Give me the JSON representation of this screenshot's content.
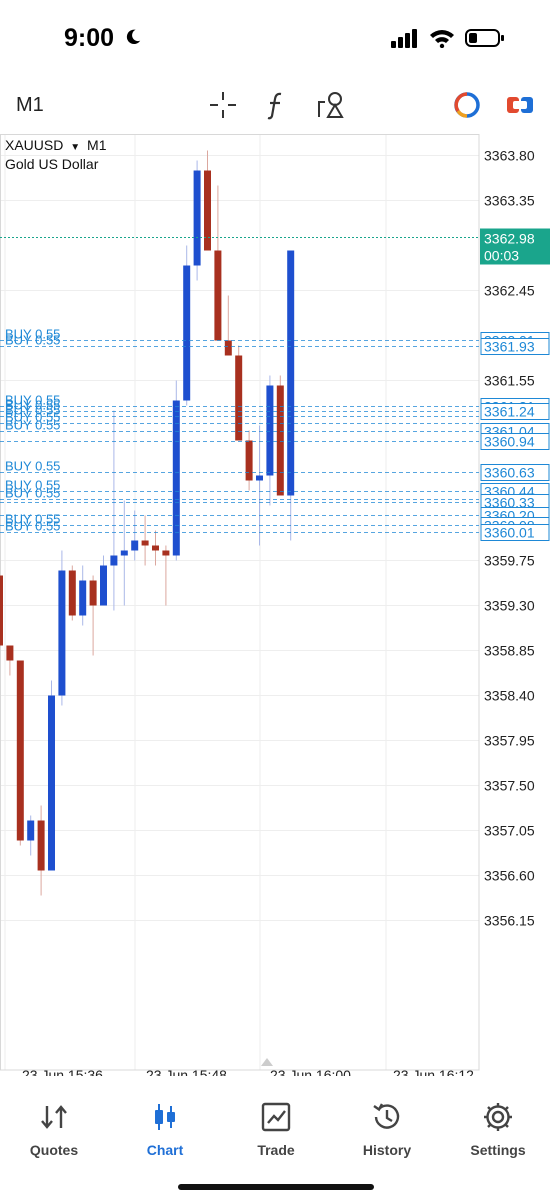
{
  "status": {
    "time": "9:00"
  },
  "toolbar": {
    "timeframe": "M1",
    "icons": [
      "crosshair-icon",
      "indicators-f-icon",
      "objects-icon",
      "color-scheme-icon",
      "one-click-trading-icon"
    ]
  },
  "chart": {
    "symbol": "XAUUSD",
    "timeframe": "M1",
    "description": "Gold US Dollar",
    "current_price": "3362.98",
    "countdown": "00:03",
    "colors": {
      "bull": "#1e4fcf",
      "bear": "#a8301f",
      "order_line": "#1e88d6",
      "bid_line": "#1aa58c",
      "grid": "#eeeeee"
    }
  },
  "chart_data": {
    "type": "candlestick",
    "y_ticks": [
      "3363.80",
      "3363.35",
      "3362.45",
      "3361.55",
      "3359.75",
      "3359.30",
      "3358.85",
      "3358.40",
      "3357.95",
      "3357.50",
      "3357.05",
      "3356.60",
      "3356.15"
    ],
    "x_ticks": [
      "23 Jun 15:36",
      "23 Jun 15:48",
      "23 Jun 16:00",
      "23 Jun 16:12"
    ],
    "ylim": [
      3355.8,
      3364.0
    ],
    "candles": [
      {
        "o": 3359.6,
        "h": 3359.65,
        "l": 3358.8,
        "c": 3358.9
      },
      {
        "o": 3358.9,
        "h": 3358.9,
        "l": 3358.6,
        "c": 3358.75
      },
      {
        "o": 3358.75,
        "h": 3358.75,
        "l": 3356.9,
        "c": 3356.95
      },
      {
        "o": 3356.95,
        "h": 3357.2,
        "l": 3356.8,
        "c": 3357.15
      },
      {
        "o": 3357.15,
        "h": 3357.3,
        "l": 3356.4,
        "c": 3356.65
      },
      {
        "o": 3356.65,
        "h": 3358.55,
        "l": 3356.65,
        "c": 3358.4
      },
      {
        "o": 3358.4,
        "h": 3359.85,
        "l": 3358.3,
        "c": 3359.65
      },
      {
        "o": 3359.65,
        "h": 3359.7,
        "l": 3359.15,
        "c": 3359.2
      },
      {
        "o": 3359.2,
        "h": 3359.7,
        "l": 3359.1,
        "c": 3359.55
      },
      {
        "o": 3359.55,
        "h": 3359.6,
        "l": 3358.8,
        "c": 3359.3
      },
      {
        "o": 3359.3,
        "h": 3359.8,
        "l": 3359.3,
        "c": 3359.7
      },
      {
        "o": 3359.7,
        "h": 3361.25,
        "l": 3359.25,
        "c": 3359.8
      },
      {
        "o": 3359.8,
        "h": 3360.35,
        "l": 3359.3,
        "c": 3359.85
      },
      {
        "o": 3359.85,
        "h": 3360.25,
        "l": 3359.75,
        "c": 3359.95
      },
      {
        "o": 3359.95,
        "h": 3360.2,
        "l": 3359.7,
        "c": 3359.9
      },
      {
        "o": 3359.9,
        "h": 3360.05,
        "l": 3359.7,
        "c": 3359.85
      },
      {
        "o": 3359.85,
        "h": 3359.9,
        "l": 3359.3,
        "c": 3359.8
      },
      {
        "o": 3359.8,
        "h": 3361.55,
        "l": 3359.75,
        "c": 3361.35
      },
      {
        "o": 3361.35,
        "h": 3362.9,
        "l": 3361.3,
        "c": 3362.7
      },
      {
        "o": 3362.7,
        "h": 3363.75,
        "l": 3362.55,
        "c": 3363.65
      },
      {
        "o": 3363.65,
        "h": 3363.85,
        "l": 3362.85,
        "c": 3362.85
      },
      {
        "o": 3362.85,
        "h": 3363.5,
        "l": 3361.95,
        "c": 3361.95
      },
      {
        "o": 3361.95,
        "h": 3362.4,
        "l": 3361.9,
        "c": 3361.8
      },
      {
        "o": 3361.8,
        "h": 3361.9,
        "l": 3360.95,
        "c": 3360.95
      },
      {
        "o": 3360.95,
        "h": 3361.05,
        "l": 3360.45,
        "c": 3360.55
      },
      {
        "o": 3360.55,
        "h": 3361.1,
        "l": 3359.9,
        "c": 3360.6
      },
      {
        "o": 3360.6,
        "h": 3361.6,
        "l": 3360.3,
        "c": 3361.5
      },
      {
        "o": 3361.5,
        "h": 3361.6,
        "l": 3360.4,
        "c": 3360.4
      },
      {
        "o": 3360.4,
        "h": 3362.85,
        "l": 3359.95,
        "c": 3362.85
      }
    ],
    "buy_orders": [
      {
        "label": "BUY 0.55",
        "price": 3361.95,
        "price_label": "3362.01"
      },
      {
        "label": "BUY 0.55",
        "price": 3361.89,
        "price_label": "3361.93"
      },
      {
        "label": "BUY 0.55",
        "price": 3361.29,
        "price_label": "3361.31"
      },
      {
        "label": "BUY 0.55",
        "price": 3361.24,
        "price_label": "3361.24"
      },
      {
        "label": "BUY 0.55",
        "price": 3361.19,
        "price_label": ""
      },
      {
        "label": "BUY 0.55",
        "price": 3361.12,
        "price_label": ""
      },
      {
        "label": "BUY 0.55",
        "price": 3361.04,
        "price_label": "3361.04"
      },
      {
        "label": "",
        "price": 3360.94,
        "price_label": "3360.94"
      },
      {
        "label": "BUY 0.55",
        "price": 3360.63,
        "price_label": "3360.63"
      },
      {
        "label": "BUY 0.55",
        "price": 3360.44,
        "price_label": "3360.44"
      },
      {
        "label": "BUY 0.55",
        "price": 3360.36,
        "price_label": ""
      },
      {
        "label": "",
        "price": 3360.33,
        "price_label": "3360.33"
      },
      {
        "label": "",
        "price": 3360.2,
        "price_label": "3360.20"
      },
      {
        "label": "BUY 0.55",
        "price": 3360.1,
        "price_label": "3360.08"
      },
      {
        "label": "BUY 0.55",
        "price": 3360.03,
        "price_label": "3360.01"
      }
    ],
    "bid_price": 3362.98
  },
  "tabs": [
    {
      "label": "Quotes",
      "icon": "quotes-arrows-icon",
      "active": false
    },
    {
      "label": "Chart",
      "icon": "candlestick-icon",
      "active": true
    },
    {
      "label": "Trade",
      "icon": "trade-chart-icon",
      "active": false
    },
    {
      "label": "History",
      "icon": "history-clock-icon",
      "active": false
    },
    {
      "label": "Settings",
      "icon": "settings-gear-icon",
      "active": false
    }
  ]
}
